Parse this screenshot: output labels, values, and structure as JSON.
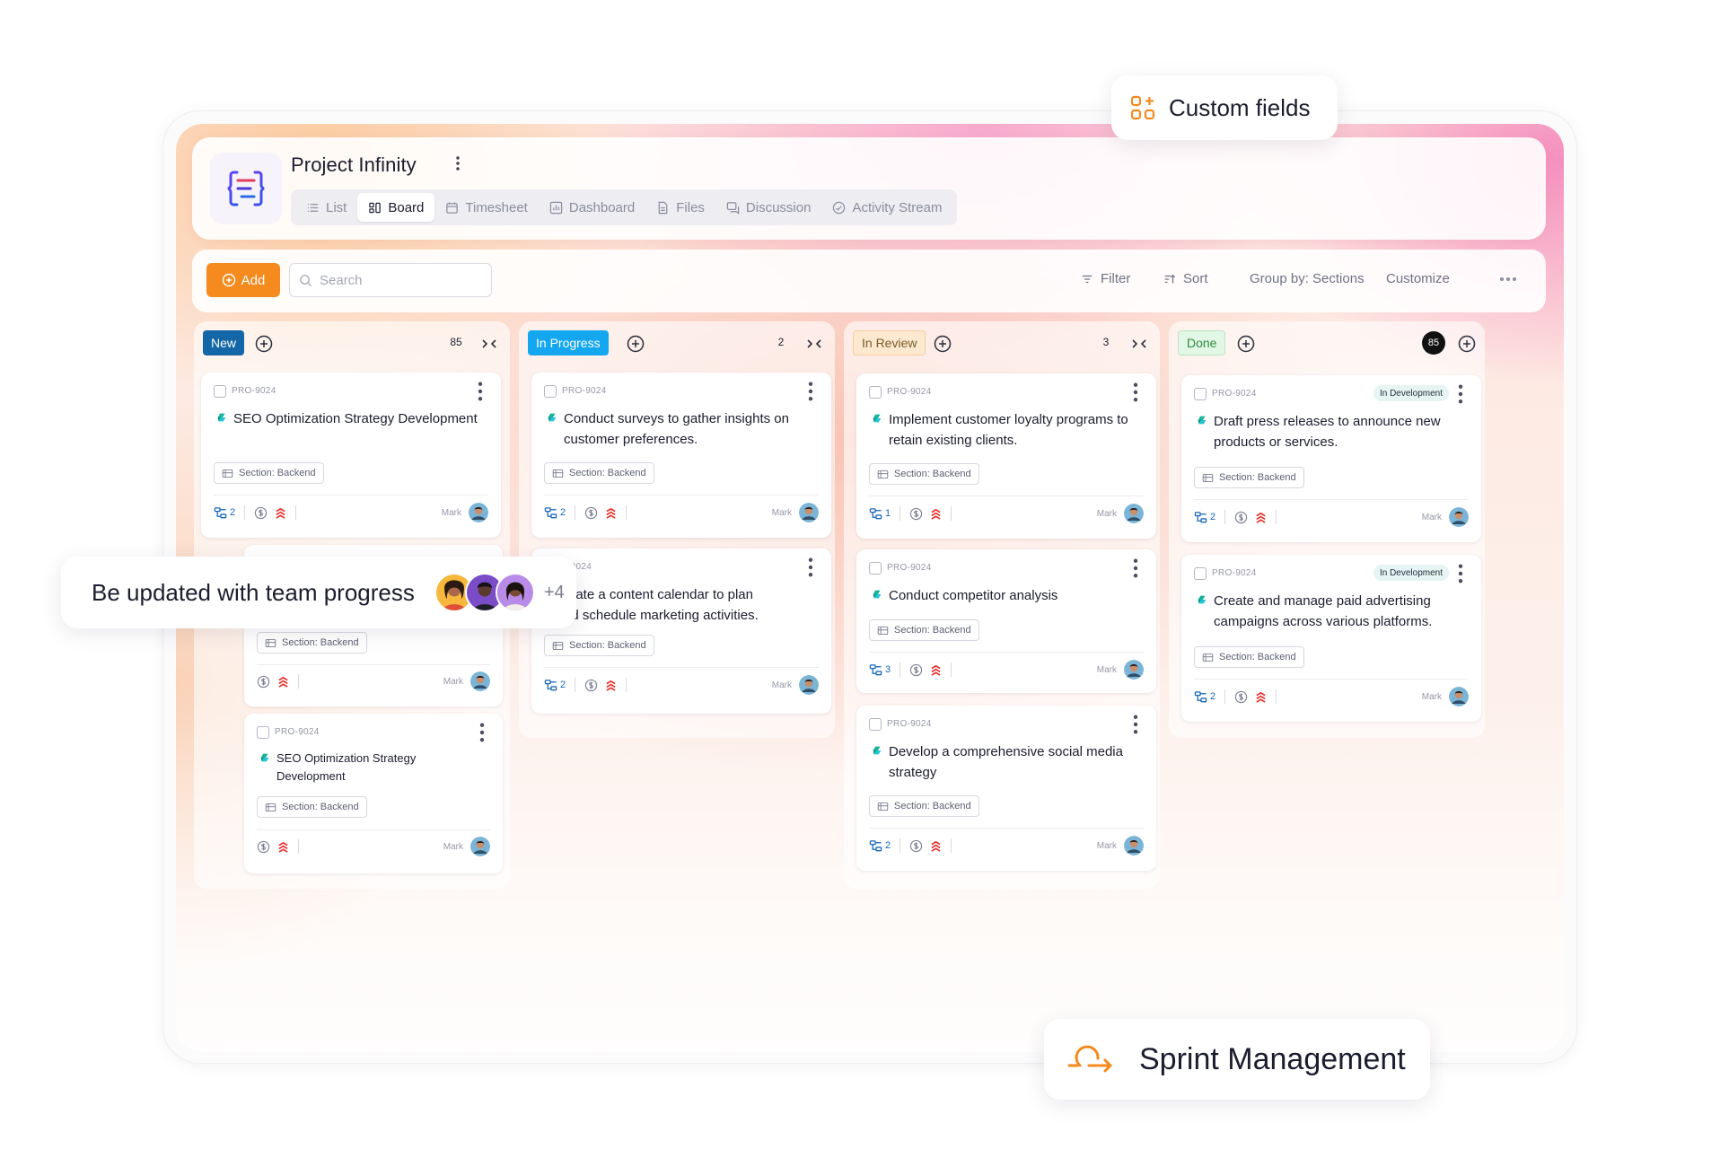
{
  "header": {
    "title": "Project Infinity",
    "tabs": [
      {
        "label": "List",
        "icon": "list-icon",
        "active": false
      },
      {
        "label": "Board",
        "icon": "board-icon",
        "active": true
      },
      {
        "label": "Timesheet",
        "icon": "calendar-icon",
        "active": false
      },
      {
        "label": "Dashboard",
        "icon": "chart-icon",
        "active": false
      },
      {
        "label": "Files",
        "icon": "file-icon",
        "active": false
      },
      {
        "label": "Discussion",
        "icon": "chat-icon",
        "active": false
      },
      {
        "label": "Activity Stream",
        "icon": "activity-icon",
        "active": false
      }
    ]
  },
  "toolbar": {
    "add_label": "Add",
    "search_placeholder": "Search",
    "filter_label": "Filter",
    "sort_label": "Sort",
    "group_label": "Group by: Sections",
    "customize_label": "Customize"
  },
  "columns": [
    {
      "status": "New",
      "count": "85",
      "color": "#1366a8",
      "text_color": "#ffffff"
    },
    {
      "status": "In Progress",
      "count": "2",
      "color": "#14a7ef",
      "text_color": "#ffffff"
    },
    {
      "status": "In Review",
      "count": "3",
      "color": "#fde9cf",
      "text_color": "#7a5a2a"
    },
    {
      "status": "Done",
      "count": "85",
      "color": "#e3f7e6",
      "text_color": "#2f8a3f"
    }
  ],
  "cards": {
    "new_1": {
      "id": "PRO-9024",
      "title": "SEO Optimization Strategy Development",
      "section": "Section: Backend",
      "subtasks": "2",
      "assignee": "Mark"
    },
    "new_2": {
      "section": "Section: Backend",
      "assignee": "Mark"
    },
    "new_3": {
      "id": "PRO-9024",
      "title": "SEO Optimization Strategy Development",
      "section": "Section: Backend",
      "assignee": "Mark"
    },
    "prog_1": {
      "id": "PRO-9024",
      "title": "Conduct surveys to gather insights on customer preferences.",
      "section": "Section: Backend",
      "subtasks": "2",
      "assignee": "Mark"
    },
    "prog_2": {
      "id": "-9024",
      "title_line1": "reate a content calendar to plan",
      "title_line2": "nd schedule marketing activities.",
      "section": "Section: Backend",
      "subtasks": "2",
      "assignee": "Mark"
    },
    "rev_1": {
      "id": "PRO-9024",
      "title": "Implement customer loyalty programs to retain existing clients.",
      "section": "Section: Backend",
      "subtasks": "1",
      "assignee": "Mark"
    },
    "rev_2": {
      "id": "PRO-9024",
      "title": "Conduct competitor analysis",
      "section": "Section: Backend",
      "subtasks": "3",
      "assignee": "Mark"
    },
    "rev_3": {
      "id": "PRO-9024",
      "title": "Develop a comprehensive social media strategy",
      "section": "Section: Backend",
      "subtasks": "2",
      "assignee": "Mark"
    },
    "done_1": {
      "id": "PRO-9024",
      "badge": "In Development",
      "title": "Draft press releases to announce new products or services.",
      "section": "Section: Backend",
      "subtasks": "2",
      "assignee": "Mark"
    },
    "done_2": {
      "id": "PRO-9024",
      "badge": "In Development",
      "title": "Create and manage paid advertising campaigns across various platforms.",
      "section": "Section: Backend",
      "subtasks": "2",
      "assignee": "Mark"
    }
  },
  "callouts": {
    "custom_fields": "Custom fields",
    "team_progress": "Be updated with team progress",
    "team_extra": "+4",
    "sprint": "Sprint Management"
  },
  "colors": {
    "accent_orange": "#f58a1f",
    "priority_red": "#e5332f",
    "subtask_blue": "#1967b8",
    "title_icon_green": "#16b39a"
  }
}
